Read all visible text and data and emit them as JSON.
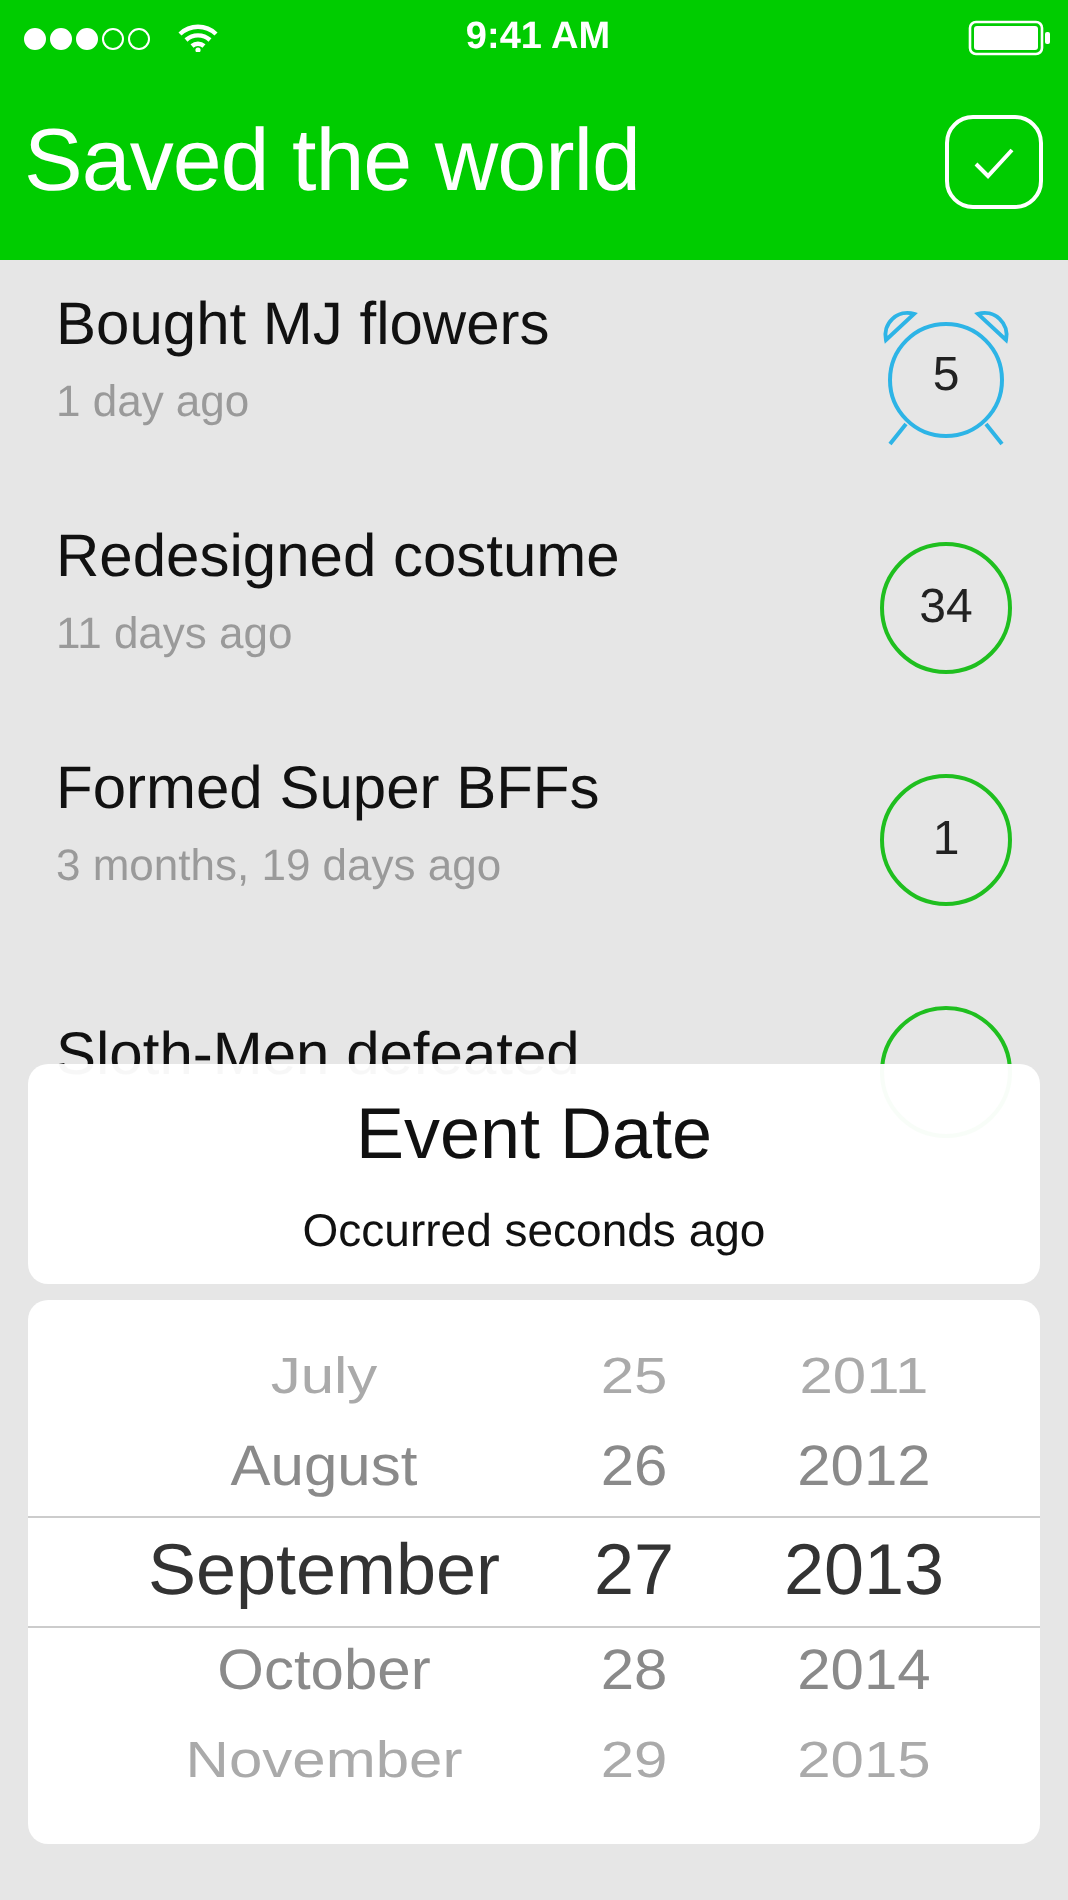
{
  "status_bar": {
    "time": "9:41 AM",
    "signal_dots": [
      {
        "on": true
      },
      {
        "on": true
      },
      {
        "on": true
      },
      {
        "on": false
      },
      {
        "on": false
      }
    ]
  },
  "nav": {
    "title": "Saved the world"
  },
  "events": [
    {
      "title": "Bought MJ flowers",
      "subtitle": "1 day ago",
      "count": "5",
      "kind": "alarm"
    },
    {
      "title": "Redesigned costume",
      "subtitle": "11 days ago",
      "count": "34",
      "kind": "circle"
    },
    {
      "title": "Formed Super BFFs",
      "subtitle": "3 months, 19 days ago",
      "count": "1",
      "kind": "circle"
    },
    {
      "title": "Sloth-Men defeated",
      "kind": "circle"
    }
  ],
  "sheet": {
    "title": "Event Date",
    "subtitle": "Occurred seconds ago"
  },
  "picker": {
    "columns": [
      {
        "kind": "month",
        "items": [
          {
            "label": "July",
            "selected": false
          },
          {
            "label": "August",
            "selected": false
          },
          {
            "label": "September",
            "selected": true
          },
          {
            "label": "October",
            "selected": false
          },
          {
            "label": "November",
            "selected": false
          }
        ]
      },
      {
        "kind": "day",
        "items": [
          {
            "label": "25",
            "selected": false
          },
          {
            "label": "26",
            "selected": false
          },
          {
            "label": "27",
            "selected": true
          },
          {
            "label": "28",
            "selected": false
          },
          {
            "label": "29",
            "selected": false
          }
        ]
      },
      {
        "kind": "year",
        "items": [
          {
            "label": "2011",
            "selected": false
          },
          {
            "label": "2012",
            "selected": false
          },
          {
            "label": "2013",
            "selected": true
          },
          {
            "label": "2014",
            "selected": false
          },
          {
            "label": "2015",
            "selected": false
          }
        ]
      }
    ]
  }
}
